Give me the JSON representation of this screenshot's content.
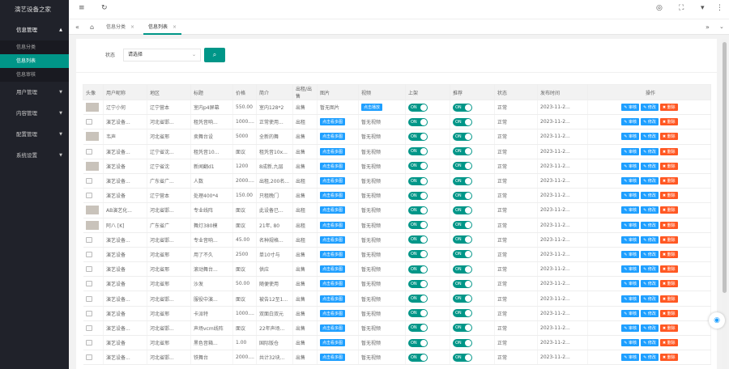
{
  "app": {
    "title": "演艺设备之家"
  },
  "sidebar": {
    "menu": [
      {
        "label": "信息管理",
        "open": true,
        "sub": [
          {
            "label": "信息分类",
            "active": false
          },
          {
            "label": "信息列表",
            "active": true
          },
          {
            "label": "信息审核",
            "active": false
          }
        ]
      },
      {
        "label": "用户管理"
      },
      {
        "label": "内容管理"
      },
      {
        "label": "配置管理"
      },
      {
        "label": "系统设置"
      }
    ]
  },
  "topbar": {
    "menu_icon": "≡",
    "refresh_icon": "↻",
    "right_icons": [
      "◎",
      "⛶",
      "▾",
      "⋮"
    ]
  },
  "tabs": [
    {
      "label": "信息分类",
      "active": false
    },
    {
      "label": "信息列表",
      "active": true
    }
  ],
  "filter": {
    "label": "状态",
    "select_value": "请选择",
    "search_icon": "⌕"
  },
  "table": {
    "headers": [
      "头像",
      "用户昵称",
      "地区",
      "标题",
      "价格",
      "简介",
      "出租/出售",
      "图片",
      "视频",
      "上架",
      "推荐",
      "状态",
      "发布时间",
      "操作"
    ],
    "switch_on": "ON",
    "ops": {
      "review": "审核",
      "edit": "修改",
      "del": "删除"
    },
    "rows": [
      {
        "avatar": "photo",
        "nick": "辽宁小何",
        "region": "辽宁营本",
        "title": "室内p4屏幕",
        "price": "550.00",
        "intro": "室内128*2",
        "type": "出售",
        "image": "暂无图片",
        "video": "点击播放",
        "status": "正常",
        "time": "2023-11-2..."
      },
      {
        "avatar": "broken",
        "nick": "演艺设备...",
        "region": "河北省邯...",
        "title": "租凭音响...",
        "price": "1000....",
        "intro": "正常使用...",
        "type": "出租",
        "image": "点击看多图",
        "video": "暂无视频",
        "status": "正常",
        "time": "2023-11-2..."
      },
      {
        "avatar": "photo",
        "nick": "韦声",
        "region": "河北省邢",
        "title": "卖舞台设",
        "price": "5000",
        "intro": "全新的舞",
        "type": "出售",
        "image": "点击看多图",
        "video": "暂无视频",
        "status": "正常",
        "time": "2023-11-2..."
      },
      {
        "avatar": "broken",
        "nick": "演艺设备...",
        "region": "辽宁省沈...",
        "title": "租凭音10...",
        "price": "面议",
        "intro": "租凭音10x...",
        "type": "出售",
        "image": "点击看多图",
        "video": "暂无视频",
        "status": "正常",
        "time": "2023-11-2..."
      },
      {
        "avatar": "photo",
        "nick": "演艺设备",
        "region": "辽宁省沈",
        "title": "新闻翻d1",
        "price": "1200",
        "intro": "8成新,九层",
        "type": "出售",
        "image": "点击看多图",
        "video": "暂无视频",
        "status": "正常",
        "time": "2023-11-2..."
      },
      {
        "avatar": "broken",
        "nick": "演艺设备...",
        "region": "广东省广...",
        "title": "人数",
        "price": "2000....",
        "intro": "出租,200名...",
        "type": "出租",
        "image": "点击看多图",
        "video": "暂无视频",
        "status": "正常",
        "time": "2023-11-2..."
      },
      {
        "avatar": "broken",
        "nick": "演艺设备",
        "region": "辽宁营本",
        "title": "处理400*4",
        "price": "150.00",
        "intro": "只租晚门",
        "type": "出售",
        "image": "点击看多图",
        "video": "暂无视频",
        "status": "正常",
        "time": "2023-11-2..."
      },
      {
        "avatar": "photo",
        "nick": "AB演艺化...",
        "region": "河北省邯...",
        "title": "专业线阵",
        "price": "面议",
        "intro": "此设备已...",
        "type": "出租",
        "image": "点击看多图",
        "video": "暂无视频",
        "status": "正常",
        "time": "2023-11-2..."
      },
      {
        "avatar": "photo",
        "nick": "阿八 [K]",
        "region": "广东省广",
        "title": "舞灯380模",
        "price": "面议",
        "intro": "21年, 80",
        "type": "出租",
        "image": "点击看多图",
        "video": "暂无视频",
        "status": "正常",
        "time": "2023-11-2..."
      },
      {
        "avatar": "broken",
        "nick": "演艺设备...",
        "region": "河北省邯...",
        "title": "专业音响...",
        "price": "45.00",
        "intro": "名种规格...",
        "type": "出租",
        "image": "点击看多图",
        "video": "暂无视频",
        "status": "正常",
        "time": "2023-11-2..."
      },
      {
        "avatar": "broken",
        "nick": "演艺设备",
        "region": "河北省邢",
        "title": "用了不久",
        "price": "2500",
        "intro": "单10寸与",
        "type": "出售",
        "image": "点击看多图",
        "video": "暂无视频",
        "status": "正常",
        "time": "2023-11-2..."
      },
      {
        "avatar": "broken",
        "nick": "演艺设备",
        "region": "河北省邢",
        "title": "滚动舞台...",
        "price": "面议",
        "intro": "供应",
        "type": "出售",
        "image": "点击看多图",
        "video": "暂无视频",
        "status": "正常",
        "time": "2023-11-2..."
      },
      {
        "avatar": "broken",
        "nick": "演艺设备",
        "region": "河北省邢",
        "title": "沙发",
        "price": "50.00",
        "intro": "随便使用",
        "type": "出售",
        "image": "点击看多图",
        "video": "暂无视频",
        "status": "正常",
        "time": "2023-11-2..."
      },
      {
        "avatar": "broken",
        "nick": "演艺设备...",
        "region": "河北省邯...",
        "title": "服役中演...",
        "price": "面议",
        "intro": "被告12至1...",
        "type": "出售",
        "image": "点击看多图",
        "video": "暂无视频",
        "status": "正常",
        "time": "2023-11-2..."
      },
      {
        "avatar": "broken",
        "nick": "演艺设备",
        "region": "河北省邢",
        "title": "卡派特",
        "price": "1000....",
        "intro": "双面白双元",
        "type": "出售",
        "image": "点击看多图",
        "video": "暂无视频",
        "status": "正常",
        "time": "2023-11-2..."
      },
      {
        "avatar": "broken",
        "nick": "演艺设备...",
        "region": "河北省邯...",
        "title": "声场vcm线阵",
        "price": "面议",
        "intro": "22年声场...",
        "type": "出售",
        "image": "点击看多图",
        "video": "暂无视频",
        "status": "正常",
        "time": "2023-11-2..."
      },
      {
        "avatar": "broken",
        "nick": "演艺设备",
        "region": "河北省邢",
        "title": "黑色音箱...",
        "price": "1.00",
        "intro": "国际版仓",
        "type": "出售",
        "image": "点击看多图",
        "video": "暂无视频",
        "status": "正常",
        "time": "2023-11-2..."
      },
      {
        "avatar": "broken",
        "nick": "演艺设备...",
        "region": "河北省邯...",
        "title": "铁舞台",
        "price": "2000....",
        "intro": "共计32块...",
        "type": "出售",
        "image": "点击看多图",
        "video": "暂无视频",
        "status": "正常",
        "time": "2023-11-2..."
      }
    ]
  },
  "colors": {
    "sidebar_bg": "#20222a",
    "accent": "#009688",
    "blue_btn": "#1e9fff",
    "red_btn": "#ff5722"
  }
}
